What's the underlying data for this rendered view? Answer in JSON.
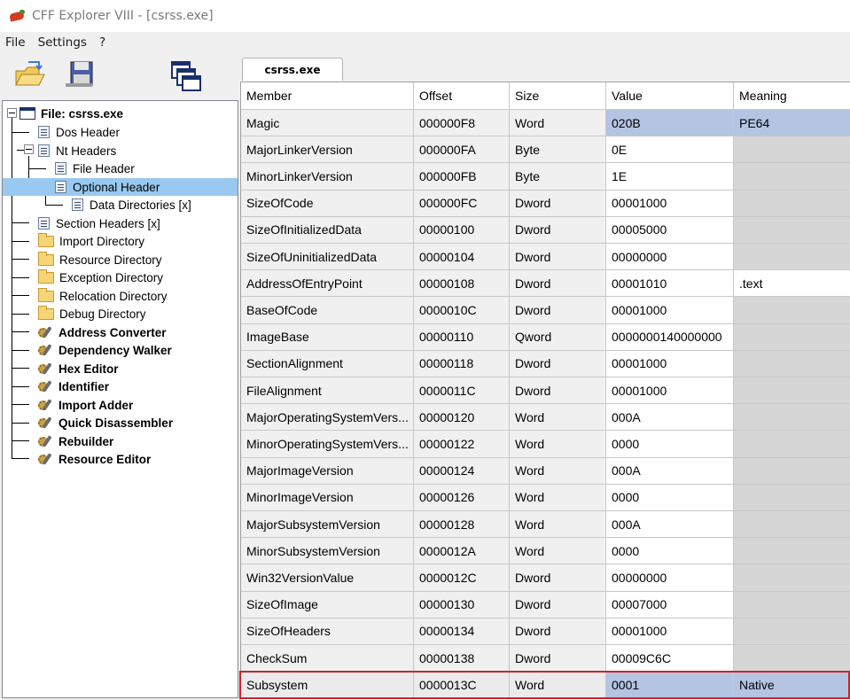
{
  "window": {
    "title": "CFF Explorer VIII - [csrss.exe]"
  },
  "menu": [
    "File",
    "Settings",
    "?"
  ],
  "toolbar": {
    "icons": [
      "open-file-icon",
      "save-icon",
      "windows-icon"
    ]
  },
  "tree": {
    "root": "File: csrss.exe",
    "items": [
      {
        "label": "Dos Header",
        "icon": "page-icon",
        "level": 1,
        "bold": false
      },
      {
        "label": "Nt Headers",
        "icon": "page-icon",
        "level": 1,
        "bold": false
      },
      {
        "label": "File Header",
        "icon": "page-icon",
        "level": 2,
        "bold": false
      },
      {
        "label": "Optional Header",
        "icon": "page-icon",
        "level": 2,
        "bold": false,
        "selected": true
      },
      {
        "label": "Data Directories [x]",
        "icon": "page-icon",
        "level": 3,
        "bold": false
      },
      {
        "label": "Section Headers [x]",
        "icon": "page-icon",
        "level": 1,
        "bold": false
      },
      {
        "label": "Import Directory",
        "icon": "folder-icon",
        "level": 1,
        "bold": false
      },
      {
        "label": "Resource Directory",
        "icon": "folder-icon",
        "level": 1,
        "bold": false
      },
      {
        "label": "Exception Directory",
        "icon": "folder-icon",
        "level": 1,
        "bold": false
      },
      {
        "label": "Relocation Directory",
        "icon": "folder-icon",
        "level": 1,
        "bold": false
      },
      {
        "label": "Debug Directory",
        "icon": "folder-icon",
        "level": 1,
        "bold": false
      },
      {
        "label": "Address Converter",
        "icon": "tool-icon",
        "level": 1,
        "bold": true
      },
      {
        "label": "Dependency Walker",
        "icon": "tool-icon",
        "level": 1,
        "bold": true
      },
      {
        "label": "Hex Editor",
        "icon": "tool-icon",
        "level": 1,
        "bold": true
      },
      {
        "label": "Identifier",
        "icon": "tool-icon",
        "level": 1,
        "bold": true
      },
      {
        "label": "Import Adder",
        "icon": "tool-icon",
        "level": 1,
        "bold": true
      },
      {
        "label": "Quick Disassembler",
        "icon": "tool-icon",
        "level": 1,
        "bold": true
      },
      {
        "label": "Rebuilder",
        "icon": "tool-icon",
        "level": 1,
        "bold": true
      },
      {
        "label": "Resource Editor",
        "icon": "tool-icon",
        "level": 1,
        "bold": true
      }
    ]
  },
  "tab": {
    "label": "csrss.exe"
  },
  "grid": {
    "columns": [
      "Member",
      "Offset",
      "Size",
      "Value",
      "Meaning"
    ],
    "rows": [
      [
        "Magic",
        "000000F8",
        "Word",
        "020B",
        "PE64"
      ],
      [
        "MajorLinkerVersion",
        "000000FA",
        "Byte",
        "0E",
        ""
      ],
      [
        "MinorLinkerVersion",
        "000000FB",
        "Byte",
        "1E",
        ""
      ],
      [
        "SizeOfCode",
        "000000FC",
        "Dword",
        "00001000",
        ""
      ],
      [
        "SizeOfInitializedData",
        "00000100",
        "Dword",
        "00005000",
        ""
      ],
      [
        "SizeOfUninitializedData",
        "00000104",
        "Dword",
        "00000000",
        ""
      ],
      [
        "AddressOfEntryPoint",
        "00000108",
        "Dword",
        "00001010",
        ".text"
      ],
      [
        "BaseOfCode",
        "0000010C",
        "Dword",
        "00001000",
        ""
      ],
      [
        "ImageBase",
        "00000110",
        "Qword",
        "0000000140000000",
        ""
      ],
      [
        "SectionAlignment",
        "00000118",
        "Dword",
        "00001000",
        ""
      ],
      [
        "FileAlignment",
        "0000011C",
        "Dword",
        "00001000",
        ""
      ],
      [
        "MajorOperatingSystemVers...",
        "00000120",
        "Word",
        "000A",
        ""
      ],
      [
        "MinorOperatingSystemVers...",
        "00000122",
        "Word",
        "0000",
        ""
      ],
      [
        "MajorImageVersion",
        "00000124",
        "Word",
        "000A",
        ""
      ],
      [
        "MinorImageVersion",
        "00000126",
        "Word",
        "0000",
        ""
      ],
      [
        "MajorSubsystemVersion",
        "00000128",
        "Word",
        "000A",
        ""
      ],
      [
        "MinorSubsystemVersion",
        "0000012A",
        "Word",
        "0000",
        ""
      ],
      [
        "Win32VersionValue",
        "0000012C",
        "Dword",
        "00000000",
        ""
      ],
      [
        "SizeOfImage",
        "00000130",
        "Dword",
        "00007000",
        ""
      ],
      [
        "SizeOfHeaders",
        "00000134",
        "Dword",
        "00001000",
        ""
      ],
      [
        "CheckSum",
        "00000138",
        "Dword",
        "00009C6C",
        ""
      ],
      [
        "Subsystem",
        "0000013C",
        "Word",
        "0001",
        "Native"
      ]
    ],
    "selected_row": 0,
    "marked_row": 21
  },
  "colors": {
    "selection": "#b4c4e2",
    "tree_selection": "#99c9f0",
    "marker": "#d0202e"
  }
}
